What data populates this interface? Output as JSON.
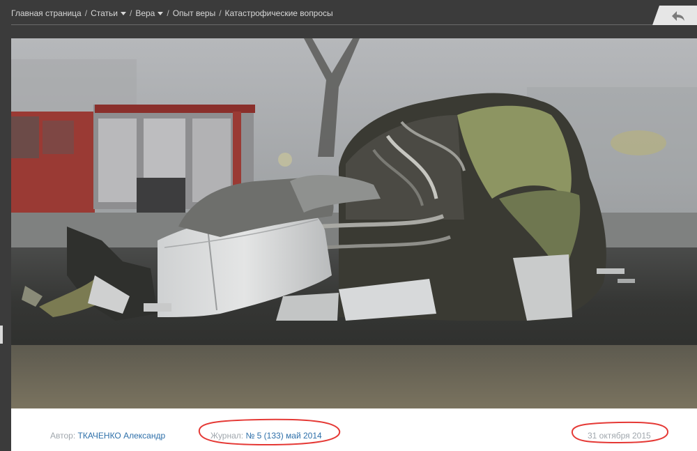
{
  "breadcrumb": {
    "home": "Главная страница",
    "articles": "Статьи",
    "faith": "Вера",
    "experience": "Опыт веры",
    "current": "Катастрофические вопросы"
  },
  "article": {
    "author_label": "Автор:",
    "author_name": "ТКАЧЕНКО Александр",
    "journal_label": "Журнал:",
    "journal_issue": "№ 5 (133) май 2014",
    "date": "31 октября 2015"
  },
  "colors": {
    "topbar": "#3b3b3b",
    "link": "#2d6fa9",
    "annotation": "#e53935"
  },
  "icons": {
    "back": "back-arrow-icon"
  }
}
